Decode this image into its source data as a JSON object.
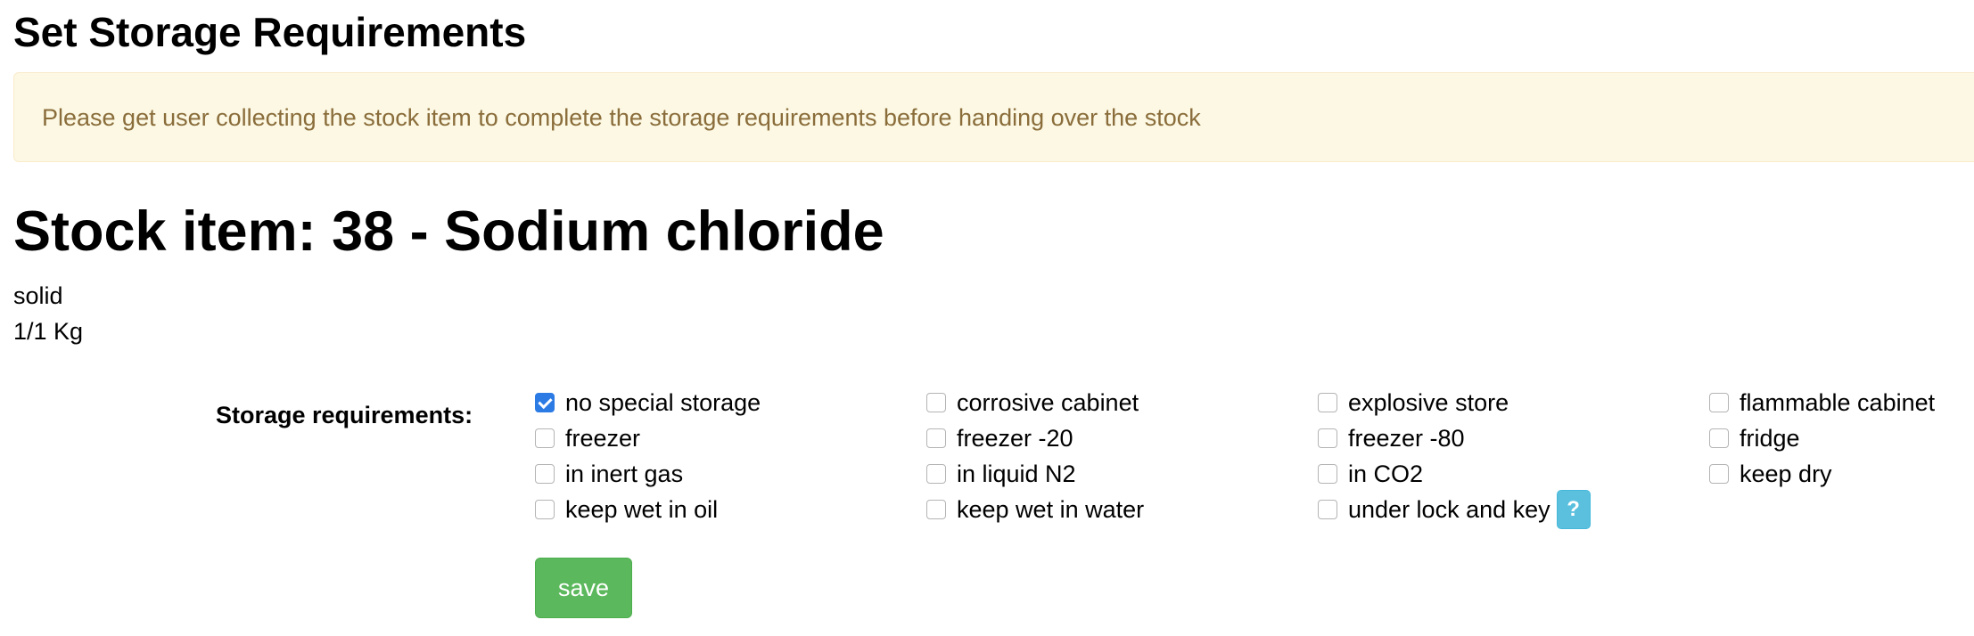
{
  "page": {
    "title": "Set Storage Requirements"
  },
  "alert": {
    "message": "Please get user collecting the stock item to complete the storage requirements before handing over the stock"
  },
  "stock_item": {
    "heading": "Stock item: 38 - Sodium chloride",
    "state": "solid",
    "quantity": "1/1 Kg"
  },
  "storage": {
    "label": "Storage requirements:",
    "options": [
      {
        "label": "no special storage",
        "checked": true
      },
      {
        "label": "corrosive cabinet",
        "checked": false
      },
      {
        "label": "explosive store",
        "checked": false
      },
      {
        "label": "flammable cabinet",
        "checked": false
      },
      {
        "label": "freezer",
        "checked": false
      },
      {
        "label": "freezer -20",
        "checked": false
      },
      {
        "label": "freezer -80",
        "checked": false
      },
      {
        "label": "fridge",
        "checked": false
      },
      {
        "label": "in inert gas",
        "checked": false
      },
      {
        "label": "in liquid N2",
        "checked": false
      },
      {
        "label": "in CO2",
        "checked": false
      },
      {
        "label": "keep dry",
        "checked": false
      },
      {
        "label": "keep wet in oil",
        "checked": false
      },
      {
        "label": "keep wet in water",
        "checked": false
      },
      {
        "label": "under lock and key",
        "checked": false
      }
    ],
    "help_label": "?"
  },
  "actions": {
    "save_label": "save"
  },
  "colors": {
    "alert_background": "#fcf8e3",
    "alert_text": "#8a6d3b",
    "checkbox_checked": "#2c7be5",
    "help_button": "#5bc0de",
    "save_button": "#5cb85c"
  }
}
